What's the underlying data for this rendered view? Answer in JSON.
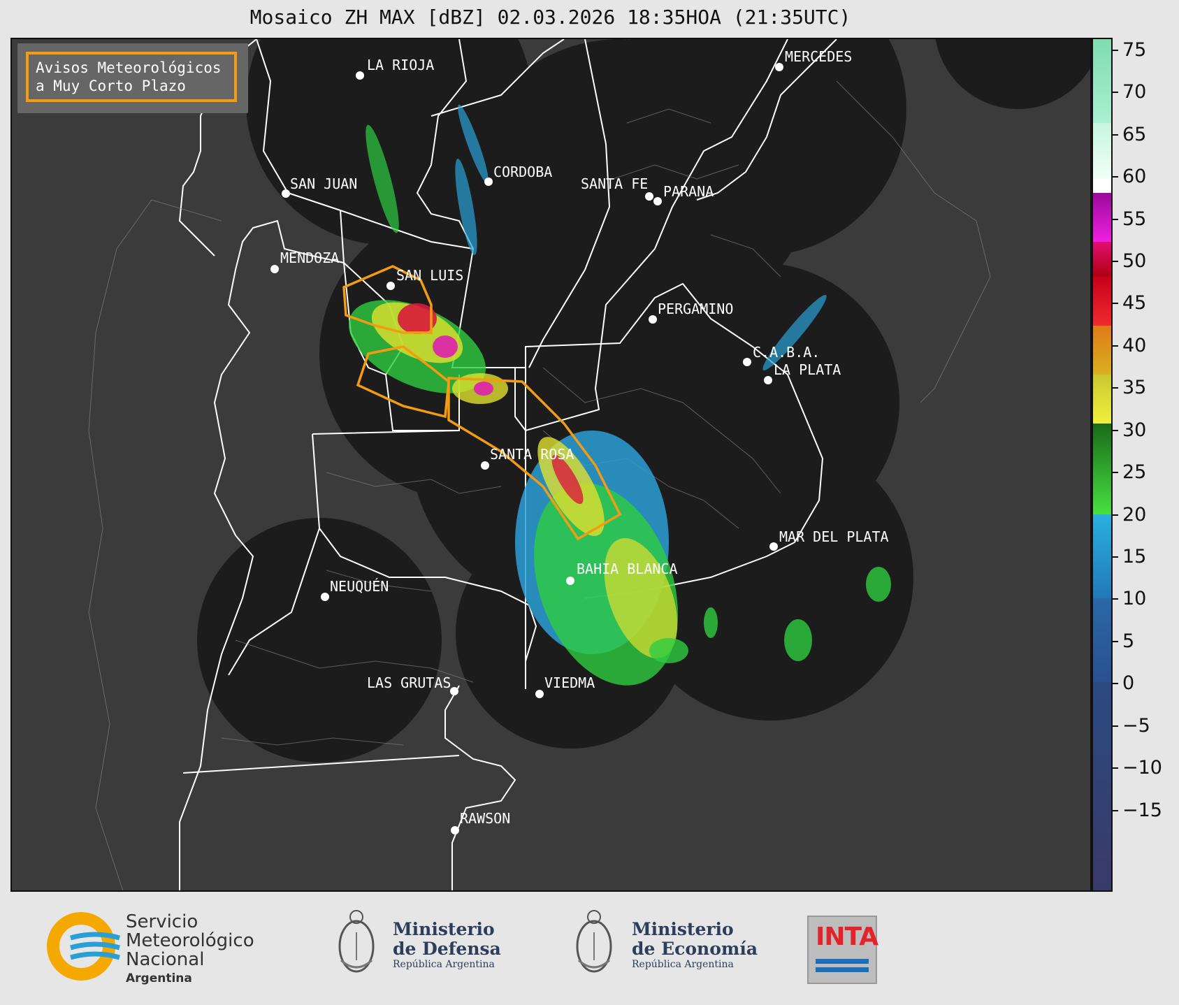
{
  "title": "Mosaico ZH MAX [dBZ] 02.03.2026 18:35HOA (21:35UTC)",
  "legend": {
    "line1": "Avisos Meteorológicos",
    "line2": "a Muy Corto Plazo",
    "color": "#f39c12"
  },
  "cities": [
    {
      "name": "LA RIOJA"
    },
    {
      "name": "MERCEDES"
    },
    {
      "name": "SAN JUAN"
    },
    {
      "name": "CORDOBA"
    },
    {
      "name": "SANTA FE"
    },
    {
      "name": "PARANA"
    },
    {
      "name": "MENDOZA"
    },
    {
      "name": "SAN LUIS"
    },
    {
      "name": "PERGAMINO"
    },
    {
      "name": "C.A.B.A."
    },
    {
      "name": "LA PLATA"
    },
    {
      "name": "SANTA ROSA"
    },
    {
      "name": "MAR DEL PLATA"
    },
    {
      "name": "BAHIA BLANCA"
    },
    {
      "name": "NEUQUÉN"
    },
    {
      "name": "LAS GRUTAS"
    },
    {
      "name": "VIEDMA"
    },
    {
      "name": "RAWSON"
    }
  ],
  "colorbar": {
    "ticks": [
      "75",
      "70",
      "65",
      "60",
      "55",
      "50",
      "45",
      "40",
      "35",
      "30",
      "25",
      "20",
      "15",
      "10",
      "5",
      "0",
      "−5",
      "−10",
      "−15"
    ],
    "range": [
      -19,
      77
    ]
  },
  "footer": {
    "smn": {
      "line1": "Servicio",
      "line2": "Meteorológico",
      "line3": "Nacional",
      "sub": "Argentina"
    },
    "defensa": {
      "line1": "Ministerio",
      "line2": "de Defensa",
      "sub": "República Argentina"
    },
    "economia": {
      "line1": "Ministerio",
      "line2": "de Economía",
      "sub": "República Argentina"
    },
    "inta": "INTA"
  }
}
